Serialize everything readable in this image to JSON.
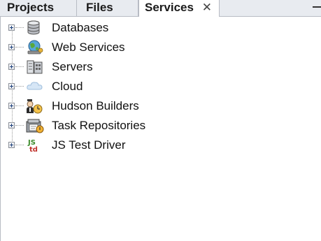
{
  "tabs": {
    "projects": "Projects",
    "files": "Files",
    "services": "Services",
    "close_glyph": "✕"
  },
  "tree": {
    "items": [
      {
        "label": "Databases",
        "icon": "database-icon"
      },
      {
        "label": "Web Services",
        "icon": "web-services-icon"
      },
      {
        "label": "Servers",
        "icon": "servers-icon"
      },
      {
        "label": "Cloud",
        "icon": "cloud-icon"
      },
      {
        "label": "Hudson Builders",
        "icon": "hudson-butler-icon"
      },
      {
        "label": "Task Repositories",
        "icon": "task-repository-icon"
      },
      {
        "label": "JS Test Driver",
        "icon": "js-test-driver-icon"
      }
    ]
  }
}
